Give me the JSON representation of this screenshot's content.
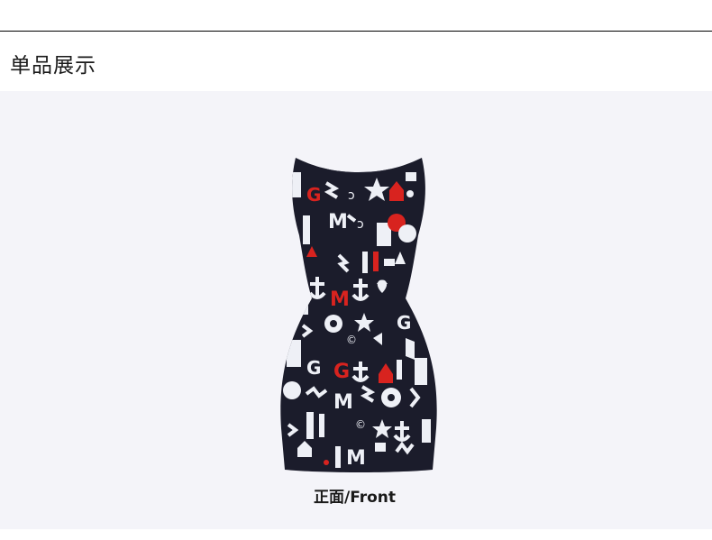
{
  "section": {
    "title": "单品展示"
  },
  "product": {
    "view_caption": "正面/Front",
    "image_subject": "dress-front-view",
    "colors": {
      "panel_background": "#f4f4f9",
      "dress_base": "#1b1c2b",
      "print_white": "#eef0f6",
      "print_red": "#d8231f"
    }
  }
}
